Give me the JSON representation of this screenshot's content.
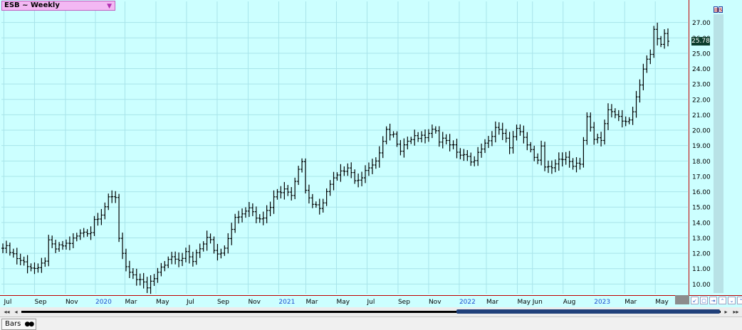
{
  "symbol_selector": {
    "label": "ESB ~ Weekly",
    "arrow": "▼"
  },
  "price_tag": "25.78",
  "status": {
    "tab_label": "Bars",
    "tab_dots": "●●"
  },
  "scroll": {
    "left_arrow": "◂",
    "right_arrow": "▸"
  },
  "colors": {
    "plot_bg": "#ccffff",
    "grid": "#a8e4ea",
    "bars": "#000000",
    "axis_border": "#c00000",
    "year_label": "#1f4fd1"
  },
  "chart_data": {
    "type": "ohlc",
    "timeframe": "weekly",
    "ylim": [
      9.0,
      28.0
    ],
    "y_ticks": [
      "10.00",
      "11.00",
      "12.00",
      "13.00",
      "14.00",
      "15.00",
      "16.00",
      "17.00",
      "18.00",
      "19.00",
      "20.00",
      "21.00",
      "22.00",
      "23.00",
      "24.00",
      "25.00",
      "26.00",
      "27.00"
    ],
    "x_ticks": [
      {
        "label": "Jul",
        "t": 0.3,
        "year": false
      },
      {
        "label": "Sep",
        "t": 9.0,
        "year": false
      },
      {
        "label": "Nov",
        "t": 17.8,
        "year": false
      },
      {
        "label": "2020",
        "t": 26.3,
        "year": true
      },
      {
        "label": "Mar",
        "t": 34.7,
        "year": false
      },
      {
        "label": "May",
        "t": 43.5,
        "year": false
      },
      {
        "label": "Jul",
        "t": 52.2,
        "year": false
      },
      {
        "label": "Sep",
        "t": 60.9,
        "year": false
      },
      {
        "label": "Nov",
        "t": 69.7,
        "year": false
      },
      {
        "label": "2021",
        "t": 78.4,
        "year": true
      },
      {
        "label": "Mar",
        "t": 86.1,
        "year": false
      },
      {
        "label": "May",
        "t": 94.8,
        "year": false
      },
      {
        "label": "Jul",
        "t": 103.5,
        "year": false
      },
      {
        "label": "Sep",
        "t": 112.3,
        "year": false
      },
      {
        "label": "Nov",
        "t": 121.0,
        "year": false
      },
      {
        "label": "2022",
        "t": 129.7,
        "year": true
      },
      {
        "label": "Mar",
        "t": 137.4,
        "year": false
      },
      {
        "label": "May",
        "t": 146.2,
        "year": false
      },
      {
        "label": "Jun",
        "t": 150.5,
        "year": false
      },
      {
        "label": "Aug",
        "t": 159.2,
        "year": false
      },
      {
        "label": "2023",
        "t": 168.0,
        "year": true
      },
      {
        "label": "Mar",
        "t": 176.7,
        "year": false
      },
      {
        "label": "May",
        "t": 185.4,
        "year": false
      }
    ],
    "close_anchors": [
      [
        0,
        12.5
      ],
      [
        2,
        12.2
      ],
      [
        4,
        11.7
      ],
      [
        6,
        11.4
      ],
      [
        8,
        11.1
      ],
      [
        10,
        10.9
      ],
      [
        12,
        11.6
      ],
      [
        13,
        12.7
      ],
      [
        15,
        12.3
      ],
      [
        17,
        12.5
      ],
      [
        19,
        12.7
      ],
      [
        21,
        13.1
      ],
      [
        23,
        13.4
      ],
      [
        25,
        13.4
      ],
      [
        26,
        14.2
      ],
      [
        28,
        14.6
      ],
      [
        30,
        15.5
      ],
      [
        32,
        15.7
      ],
      [
        33,
        13.0
      ],
      [
        34,
        12.1
      ],
      [
        35,
        11.1
      ],
      [
        36,
        10.6
      ],
      [
        38,
        10.3
      ],
      [
        40,
        10.1
      ],
      [
        41,
        9.6
      ],
      [
        42,
        10.2
      ],
      [
        44,
        10.7
      ],
      [
        46,
        11.3
      ],
      [
        48,
        11.9
      ],
      [
        50,
        11.6
      ],
      [
        52,
        12.0
      ],
      [
        54,
        11.5
      ],
      [
        56,
        12.3
      ],
      [
        58,
        13.1
      ],
      [
        59,
        13.0
      ],
      [
        60,
        12.3
      ],
      [
        62,
        11.9
      ],
      [
        64,
        13.1
      ],
      [
        66,
        14.3
      ],
      [
        68,
        14.6
      ],
      [
        70,
        15.0
      ],
      [
        72,
        14.4
      ],
      [
        74,
        14.4
      ],
      [
        76,
        15.1
      ],
      [
        78,
        16.1
      ],
      [
        80,
        16.1
      ],
      [
        82,
        15.9
      ],
      [
        84,
        17.6
      ],
      [
        85,
        18.0
      ],
      [
        86,
        16.1
      ],
      [
        88,
        15.2
      ],
      [
        90,
        14.8
      ],
      [
        92,
        16.0
      ],
      [
        94,
        16.8
      ],
      [
        96,
        17.2
      ],
      [
        98,
        17.7
      ],
      [
        100,
        16.8
      ],
      [
        101,
        16.6
      ],
      [
        103,
        17.5
      ],
      [
        105,
        17.6
      ],
      [
        107,
        18.5
      ],
      [
        109,
        19.9
      ],
      [
        111,
        19.7
      ],
      [
        113,
        18.8
      ],
      [
        115,
        19.3
      ],
      [
        117,
        19.5
      ],
      [
        119,
        19.5
      ],
      [
        121,
        19.7
      ],
      [
        123,
        20.1
      ],
      [
        124,
        19.4
      ],
      [
        126,
        19.4
      ],
      [
        128,
        18.9
      ],
      [
        130,
        18.4
      ],
      [
        132,
        18.2
      ],
      [
        134,
        18.0
      ],
      [
        136,
        18.9
      ],
      [
        138,
        19.2
      ],
      [
        140,
        20.2
      ],
      [
        142,
        19.7
      ],
      [
        144,
        19.0
      ],
      [
        146,
        20.0
      ],
      [
        148,
        19.5
      ],
      [
        150,
        18.6
      ],
      [
        152,
        18.2
      ],
      [
        153,
        18.9
      ],
      [
        154,
        17.6
      ],
      [
        156,
        17.4
      ],
      [
        158,
        18.2
      ],
      [
        160,
        18.1
      ],
      [
        162,
        17.8
      ],
      [
        164,
        17.9
      ],
      [
        166,
        20.8
      ],
      [
        168,
        19.4
      ],
      [
        170,
        19.5
      ],
      [
        172,
        21.2
      ],
      [
        174,
        21.0
      ],
      [
        176,
        20.7
      ],
      [
        178,
        20.5
      ],
      [
        180,
        22.0
      ],
      [
        182,
        23.9
      ],
      [
        184,
        25.1
      ],
      [
        185,
        26.7
      ],
      [
        186,
        25.8
      ],
      [
        187,
        25.5
      ],
      [
        188,
        26.3
      ],
      [
        189,
        25.78
      ]
    ],
    "last_close": 25.78
  }
}
